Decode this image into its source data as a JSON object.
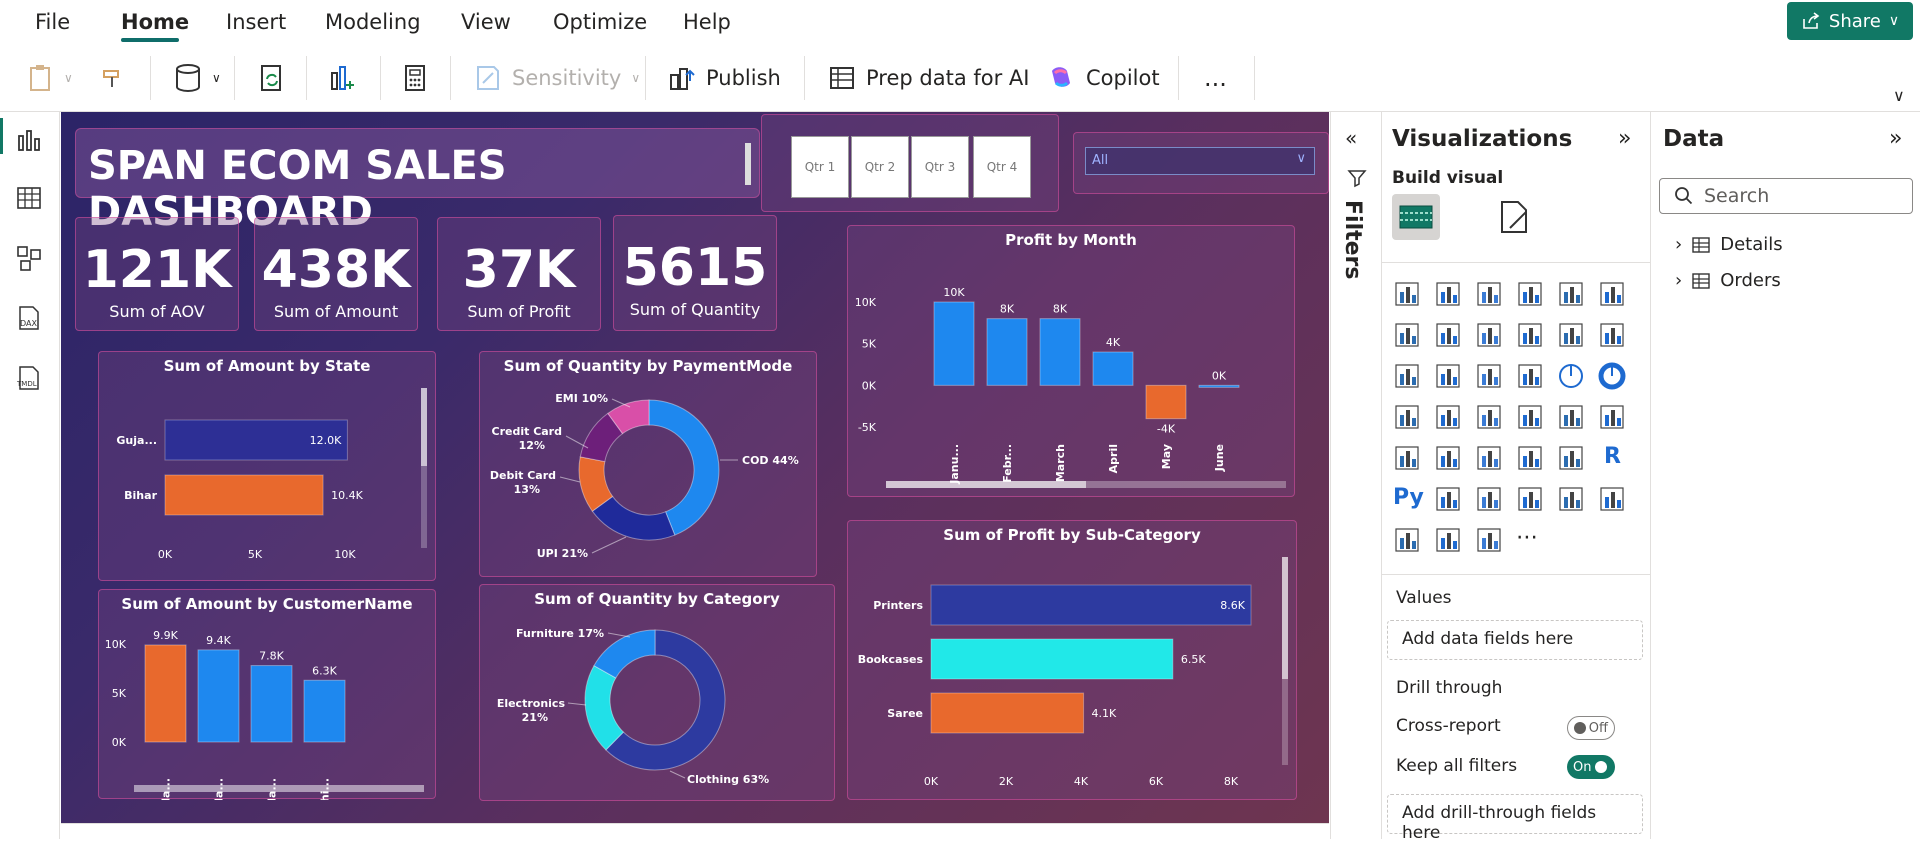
{
  "menu": {
    "file": "File",
    "home": "Home",
    "insert": "Insert",
    "modeling": "Modeling",
    "view": "View",
    "optimize": "Optimize",
    "help": "Help",
    "share": "Share"
  },
  "toolbar": {
    "sensitivity": "Sensitivity",
    "publish": "Publish",
    "prep_data": "Prep data for AI",
    "copilot": "Copilot",
    "more": "..."
  },
  "dashboard": {
    "title": "SPAN ECOM SALES DASHBOARD",
    "quarters": [
      "Qtr 1",
      "Qtr 2",
      "Qtr 3",
      "Qtr 4"
    ],
    "dropdown_value": "All",
    "kpis": [
      {
        "value": "121K",
        "label": "Sum of AOV"
      },
      {
        "value": "438K",
        "label": "Sum of Amount"
      },
      {
        "value": "37K",
        "label": "Sum of Profit"
      },
      {
        "value": "5615",
        "label": "Sum of Quantity"
      }
    ]
  },
  "chart_data": [
    {
      "type": "bar",
      "orientation": "horizontal",
      "title": "Sum of Amount by State",
      "categories": [
        "Guja...",
        "Bihar"
      ],
      "values": [
        12000,
        10400
      ],
      "data_labels": [
        "12.0K",
        "10.4K"
      ],
      "x_ticks": [
        "0K",
        "5K",
        "10K"
      ],
      "xlim": [
        0,
        12500
      ],
      "colors": [
        "#2d2f95",
        "#e8692d"
      ]
    },
    {
      "type": "pie",
      "title": "Sum of Quantity by PaymentMode",
      "categories": [
        "COD",
        "UPI",
        "Debit Card",
        "Credit Card",
        "EMI"
      ],
      "values": [
        44,
        21,
        13,
        12,
        10
      ],
      "labels": [
        "COD 44%",
        "UPI 21%",
        "Debit Card 13%",
        "Credit Card 12%",
        "EMI 10%"
      ],
      "colors": [
        "#1e88ef",
        "#1f2a9a",
        "#e8692d",
        "#6d1f7a",
        "#d94fa8"
      ]
    },
    {
      "type": "bar",
      "title": "Profit by Month",
      "categories": [
        "Janu...",
        "Febr...",
        "March",
        "April",
        "May",
        "June"
      ],
      "values": [
        10,
        8,
        8,
        4,
        -4,
        0
      ],
      "data_labels": [
        "10K",
        "8K",
        "8K",
        "4K",
        "-4K",
        "0K"
      ],
      "y_ticks": [
        "10K",
        "5K",
        "0K",
        "-5K"
      ],
      "ylim": [
        -5,
        10
      ],
      "colors": [
        "#1e88ef",
        "#1e88ef",
        "#1e88ef",
        "#1e88ef",
        "#e8692d",
        "#1e88ef"
      ]
    },
    {
      "type": "bar",
      "title": "Sum of Amount by CustomerName",
      "categories": [
        "Ha...",
        "Ma...",
        "Ma...",
        "Shi..."
      ],
      "values": [
        9.9,
        9.4,
        7.8,
        6.3
      ],
      "data_labels": [
        "9.9K",
        "9.4K",
        "7.8K",
        "6.3K"
      ],
      "y_ticks": [
        "10K",
        "5K",
        "0K"
      ],
      "ylim": [
        0,
        10
      ],
      "colors": [
        "#e8692d",
        "#1e88ef",
        "#1e88ef",
        "#1e88ef"
      ]
    },
    {
      "type": "pie",
      "title": "Sum of Quantity by Category",
      "categories": [
        "Clothing",
        "Electronics",
        "Furniture"
      ],
      "values": [
        63,
        21,
        17
      ],
      "labels": [
        "Clothing 63%",
        "Electronics 21%",
        "Furniture 17%"
      ],
      "colors": [
        "#2d3aa0",
        "#21e0e8",
        "#1e88ef"
      ]
    },
    {
      "type": "bar",
      "orientation": "horizontal",
      "title": "Sum of Profit by Sub-Category",
      "categories": [
        "Printers",
        "Bookcases",
        "Saree"
      ],
      "values": [
        8.6,
        6.5,
        4.1
      ],
      "data_labels": [
        "8.6K",
        "6.5K",
        "4.1K"
      ],
      "x_ticks": [
        "0K",
        "2K",
        "4K",
        "6K",
        "8K"
      ],
      "xlim": [
        0,
        8.6
      ],
      "colors": [
        "#2d3aa0",
        "#21e8e8",
        "#e8692d"
      ]
    }
  ],
  "filters": {
    "label": "Filters"
  },
  "visualizations": {
    "title": "Visualizations",
    "build_visual": "Build visual",
    "values_label": "Values",
    "values_placeholder": "Add data fields here",
    "drill_through": "Drill through",
    "cross_report": "Cross-report",
    "cross_report_state": "Off",
    "keep_filters": "Keep all filters",
    "keep_filters_state": "On",
    "drill_placeholder": "Add drill-through fields here"
  },
  "data_pane": {
    "title": "Data",
    "search_placeholder": "Search",
    "tables": [
      "Details",
      "Orders"
    ]
  }
}
